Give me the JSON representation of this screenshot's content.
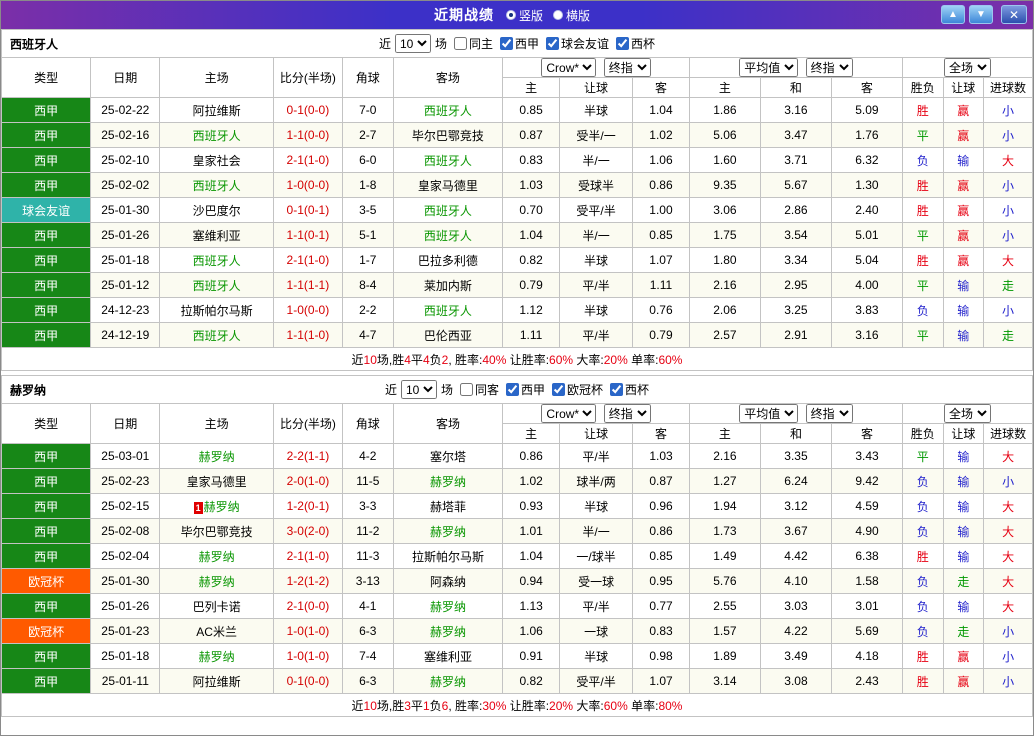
{
  "titlebar": {
    "title": "近期战绩",
    "radios": [
      {
        "label": "竖版",
        "selected": true
      },
      {
        "label": "横版",
        "selected": false
      }
    ],
    "up_icon": "▲",
    "down_icon": "▼",
    "close_icon": "✕"
  },
  "colors": {
    "league": {
      "西甲": "#178717",
      "球会友谊": "#2FB3A9",
      "欧冠杯": "#FF5A00"
    },
    "outcome": {
      "胜": "#E60012",
      "平": "#009900",
      "负": "#2222CC",
      "赢": "#E60012",
      "走": "#009900",
      "输": "#2222CC",
      "大": "#E60012",
      "小": "#2222CC"
    },
    "focal_team": "#089600",
    "score": "#D40000"
  },
  "columns": {
    "main": [
      "类型",
      "日期",
      "主场",
      "比分(半场)",
      "角球",
      "客场"
    ],
    "sub": [
      "主",
      "让球",
      "客",
      "主",
      "和",
      "客",
      "胜负",
      "让球",
      "进球数"
    ]
  },
  "tables": [
    {
      "team": "西班牙人",
      "filter": {
        "prefix": "近",
        "count": "10",
        "suffix": "场",
        "checks": [
          {
            "label": "同主",
            "checked": false
          },
          {
            "label": "西甲",
            "checked": true
          },
          {
            "label": "球会友谊",
            "checked": true
          },
          {
            "label": "西杯",
            "checked": true
          }
        ]
      },
      "selects": {
        "asian_source": "Crow*",
        "asian_kind": "终指",
        "euro_source": "平均值",
        "euro_kind": "终指",
        "scope": "全场"
      },
      "rows": [
        {
          "league": "西甲",
          "date": "25-02-22",
          "home": "阿拉维斯",
          "home_focal": false,
          "away": "西班牙人",
          "away_focal": true,
          "score": "0-1(0-0)",
          "corner": "7-0",
          "asian": [
            "0.85",
            "半球",
            "1.04"
          ],
          "euro": [
            "1.86",
            "3.16",
            "5.09"
          ],
          "results": [
            "胜",
            "赢",
            "小"
          ]
        },
        {
          "league": "西甲",
          "date": "25-02-16",
          "home": "西班牙人",
          "home_focal": true,
          "away": "毕尔巴鄂竞技",
          "away_focal": false,
          "score": "1-1(0-0)",
          "corner": "2-7",
          "asian": [
            "0.87",
            "受半/一",
            "1.02"
          ],
          "euro": [
            "5.06",
            "3.47",
            "1.76"
          ],
          "results": [
            "平",
            "赢",
            "小"
          ]
        },
        {
          "league": "西甲",
          "date": "25-02-10",
          "home": "皇家社会",
          "home_focal": false,
          "away": "西班牙人",
          "away_focal": true,
          "score": "2-1(1-0)",
          "corner": "6-0",
          "asian": [
            "0.83",
            "半/一",
            "1.06"
          ],
          "euro": [
            "1.60",
            "3.71",
            "6.32"
          ],
          "results": [
            "负",
            "输",
            "大"
          ]
        },
        {
          "league": "西甲",
          "date": "25-02-02",
          "home": "西班牙人",
          "home_focal": true,
          "away": "皇家马德里",
          "away_focal": false,
          "score": "1-0(0-0)",
          "corner": "1-8",
          "asian": [
            "1.03",
            "受球半",
            "0.86"
          ],
          "euro": [
            "9.35",
            "5.67",
            "1.30"
          ],
          "results": [
            "胜",
            "赢",
            "小"
          ]
        },
        {
          "league": "球会友谊",
          "date": "25-01-30",
          "home": "沙巴度尔",
          "home_focal": false,
          "away": "西班牙人",
          "away_focal": true,
          "score": "0-1(0-1)",
          "corner": "3-5",
          "asian": [
            "0.70",
            "受平/半",
            "1.00"
          ],
          "euro": [
            "3.06",
            "2.86",
            "2.40"
          ],
          "results": [
            "胜",
            "赢",
            "小"
          ]
        },
        {
          "league": "西甲",
          "date": "25-01-26",
          "home": "塞维利亚",
          "home_focal": false,
          "away": "西班牙人",
          "away_focal": true,
          "score": "1-1(0-1)",
          "corner": "5-1",
          "asian": [
            "1.04",
            "半/一",
            "0.85"
          ],
          "euro": [
            "1.75",
            "3.54",
            "5.01"
          ],
          "results": [
            "平",
            "赢",
            "小"
          ]
        },
        {
          "league": "西甲",
          "date": "25-01-18",
          "home": "西班牙人",
          "home_focal": true,
          "away": "巴拉多利德",
          "away_focal": false,
          "score": "2-1(1-0)",
          "corner": "1-7",
          "asian": [
            "0.82",
            "半球",
            "1.07"
          ],
          "euro": [
            "1.80",
            "3.34",
            "5.04"
          ],
          "results": [
            "胜",
            "赢",
            "大"
          ]
        },
        {
          "league": "西甲",
          "date": "25-01-12",
          "home": "西班牙人",
          "home_focal": true,
          "away": "莱加内斯",
          "away_focal": false,
          "score": "1-1(1-1)",
          "corner": "8-4",
          "asian": [
            "0.79",
            "平/半",
            "1.11"
          ],
          "euro": [
            "2.16",
            "2.95",
            "4.00"
          ],
          "results": [
            "平",
            "输",
            "走"
          ]
        },
        {
          "league": "西甲",
          "date": "24-12-23",
          "home": "拉斯帕尔马斯",
          "home_focal": false,
          "away": "西班牙人",
          "away_focal": true,
          "score": "1-0(0-0)",
          "corner": "2-2",
          "asian": [
            "1.12",
            "半球",
            "0.76"
          ],
          "euro": [
            "2.06",
            "3.25",
            "3.83"
          ],
          "results": [
            "负",
            "输",
            "小"
          ]
        },
        {
          "league": "西甲",
          "date": "24-12-19",
          "home": "西班牙人",
          "home_focal": true,
          "away": "巴伦西亚",
          "away_focal": false,
          "score": "1-1(1-0)",
          "corner": "4-7",
          "asian": [
            "1.11",
            "平/半",
            "0.79"
          ],
          "euro": [
            "2.57",
            "2.91",
            "3.16"
          ],
          "results": [
            "平",
            "输",
            "走"
          ]
        }
      ],
      "summary": [
        [
          "近",
          false
        ],
        [
          "10",
          true
        ],
        [
          "场,胜",
          false
        ],
        [
          "4",
          true
        ],
        [
          "平",
          false
        ],
        [
          "4",
          true
        ],
        [
          "负",
          false
        ],
        [
          "2",
          true
        ],
        [
          ", 胜率:",
          false
        ],
        [
          "40%",
          true
        ],
        [
          " 让胜率:",
          false
        ],
        [
          "60%",
          true
        ],
        [
          " 大率:",
          false
        ],
        [
          "20%",
          true
        ],
        [
          " 单率:",
          false
        ],
        [
          "60%",
          true
        ]
      ]
    },
    {
      "team": "赫罗纳",
      "filter": {
        "prefix": "近",
        "count": "10",
        "suffix": "场",
        "checks": [
          {
            "label": "同客",
            "checked": false
          },
          {
            "label": "西甲",
            "checked": true
          },
          {
            "label": "欧冠杯",
            "checked": true
          },
          {
            "label": "西杯",
            "checked": true
          }
        ]
      },
      "selects": {
        "asian_source": "Crow*",
        "asian_kind": "终指",
        "euro_source": "平均值",
        "euro_kind": "终指",
        "scope": "全场"
      },
      "rows": [
        {
          "league": "西甲",
          "date": "25-03-01",
          "home": "赫罗纳",
          "home_focal": true,
          "away": "塞尔塔",
          "away_focal": false,
          "score": "2-2(1-1)",
          "corner": "4-2",
          "asian": [
            "0.86",
            "平/半",
            "1.03"
          ],
          "euro": [
            "2.16",
            "3.35",
            "3.43"
          ],
          "results": [
            "平",
            "输",
            "大"
          ]
        },
        {
          "league": "西甲",
          "date": "25-02-23",
          "home": "皇家马德里",
          "home_focal": false,
          "away": "赫罗纳",
          "away_focal": true,
          "score": "2-0(1-0)",
          "corner": "11-5",
          "asian": [
            "1.02",
            "球半/两",
            "0.87"
          ],
          "euro": [
            "1.27",
            "6.24",
            "9.42"
          ],
          "results": [
            "负",
            "输",
            "小"
          ]
        },
        {
          "league": "西甲",
          "date": "25-02-15",
          "home": "赫罗纳",
          "home_focal": true,
          "home_badge": "1",
          "away": "赫塔菲",
          "away_focal": false,
          "score": "1-2(0-1)",
          "corner": "3-3",
          "asian": [
            "0.93",
            "半球",
            "0.96"
          ],
          "euro": [
            "1.94",
            "3.12",
            "4.59"
          ],
          "results": [
            "负",
            "输",
            "大"
          ]
        },
        {
          "league": "西甲",
          "date": "25-02-08",
          "home": "毕尔巴鄂竞技",
          "home_focal": false,
          "away": "赫罗纳",
          "away_focal": true,
          "score": "3-0(2-0)",
          "corner": "11-2",
          "asian": [
            "1.01",
            "半/一",
            "0.86"
          ],
          "euro": [
            "1.73",
            "3.67",
            "4.90"
          ],
          "results": [
            "负",
            "输",
            "大"
          ]
        },
        {
          "league": "西甲",
          "date": "25-02-04",
          "home": "赫罗纳",
          "home_focal": true,
          "away": "拉斯帕尔马斯",
          "away_focal": false,
          "score": "2-1(1-0)",
          "corner": "11-3",
          "asian": [
            "1.04",
            "一/球半",
            "0.85"
          ],
          "euro": [
            "1.49",
            "4.42",
            "6.38"
          ],
          "results": [
            "胜",
            "输",
            "大"
          ]
        },
        {
          "league": "欧冠杯",
          "date": "25-01-30",
          "home": "赫罗纳",
          "home_focal": true,
          "away": "阿森纳",
          "away_focal": false,
          "score": "1-2(1-2)",
          "corner": "3-13",
          "asian": [
            "0.94",
            "受一球",
            "0.95"
          ],
          "euro": [
            "5.76",
            "4.10",
            "1.58"
          ],
          "results": [
            "负",
            "走",
            "大"
          ]
        },
        {
          "league": "西甲",
          "date": "25-01-26",
          "home": "巴列卡诺",
          "home_focal": false,
          "away": "赫罗纳",
          "away_focal": true,
          "score": "2-1(0-0)",
          "corner": "4-1",
          "asian": [
            "1.13",
            "平/半",
            "0.77"
          ],
          "euro": [
            "2.55",
            "3.03",
            "3.01"
          ],
          "results": [
            "负",
            "输",
            "大"
          ]
        },
        {
          "league": "欧冠杯",
          "date": "25-01-23",
          "home": "AC米兰",
          "home_focal": false,
          "away": "赫罗纳",
          "away_focal": true,
          "score": "1-0(1-0)",
          "corner": "6-3",
          "asian": [
            "1.06",
            "一球",
            "0.83"
          ],
          "euro": [
            "1.57",
            "4.22",
            "5.69"
          ],
          "results": [
            "负",
            "走",
            "小"
          ]
        },
        {
          "league": "西甲",
          "date": "25-01-18",
          "home": "赫罗纳",
          "home_focal": true,
          "away": "塞维利亚",
          "away_focal": false,
          "score": "1-0(1-0)",
          "corner": "7-4",
          "asian": [
            "0.91",
            "半球",
            "0.98"
          ],
          "euro": [
            "1.89",
            "3.49",
            "4.18"
          ],
          "results": [
            "胜",
            "赢",
            "小"
          ]
        },
        {
          "league": "西甲",
          "date": "25-01-11",
          "home": "阿拉维斯",
          "home_focal": false,
          "away": "赫罗纳",
          "away_focal": true,
          "score": "0-1(0-0)",
          "corner": "6-3",
          "asian": [
            "0.82",
            "受平/半",
            "1.07"
          ],
          "euro": [
            "3.14",
            "3.08",
            "2.43"
          ],
          "results": [
            "胜",
            "赢",
            "小"
          ]
        }
      ],
      "summary": [
        [
          "近",
          false
        ],
        [
          "10",
          true
        ],
        [
          "场,胜",
          false
        ],
        [
          "3",
          true
        ],
        [
          "平",
          false
        ],
        [
          "1",
          true
        ],
        [
          "负",
          false
        ],
        [
          "6",
          true
        ],
        [
          ", 胜率:",
          false
        ],
        [
          "30%",
          true
        ],
        [
          " 让胜率:",
          false
        ],
        [
          "20%",
          true
        ],
        [
          " 大率:",
          false
        ],
        [
          "60%",
          true
        ],
        [
          " 单率:",
          false
        ],
        [
          "80%",
          true
        ]
      ]
    }
  ]
}
